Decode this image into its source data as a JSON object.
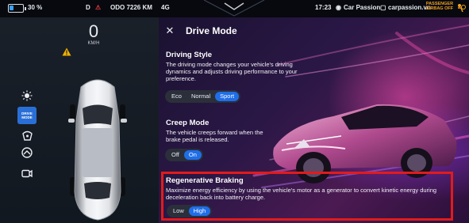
{
  "status": {
    "battery": "30 %",
    "gear": "D",
    "odo": "ODO 7226 KM",
    "network": "4G",
    "time": "17:23",
    "brand": "Car Passion",
    "site": "carpassion.vn",
    "airbag": "PASSENGER AIRBAG OFF",
    "battery_level": 0.3
  },
  "cluster": {
    "speed": "0",
    "speed_unit": "KM/H"
  },
  "sidebar": {
    "items": [
      {
        "icon": "brightness-icon",
        "label": ""
      },
      {
        "icon": "drive-mode-icon",
        "label": "DRIVE MODE"
      },
      {
        "icon": "steering-wheel-icon",
        "label": ""
      },
      {
        "icon": "speedometer-icon",
        "label": ""
      },
      {
        "icon": "camera-icon",
        "label": ""
      }
    ]
  },
  "page": {
    "title": "Drive Mode",
    "close_glyph": "✕"
  },
  "driving_style": {
    "title": "Driving Style",
    "description": "The driving mode changes your vehicle's driving dynamics  and adjusts driving performance to your preference.",
    "options": [
      "Eco",
      "Normal",
      "Sport"
    ],
    "selected": "Sport"
  },
  "creep_mode": {
    "title": "Creep Mode",
    "description": "The vehicle creeps forward when the brake pedal is released.",
    "options": [
      "Off",
      "On"
    ],
    "selected": "On"
  },
  "regen_braking": {
    "title": "Regenerative Braking",
    "description": "Maximize energy efficiency by using the vehicle's motor as a generator to convert kinetic energy during deceleration back into battery charge.",
    "options": [
      "Low",
      "High"
    ],
    "selected": "High"
  },
  "colors": {
    "accent": "#1f6ee8",
    "highlight": "#e21b1b",
    "warning": "#f0b000"
  }
}
